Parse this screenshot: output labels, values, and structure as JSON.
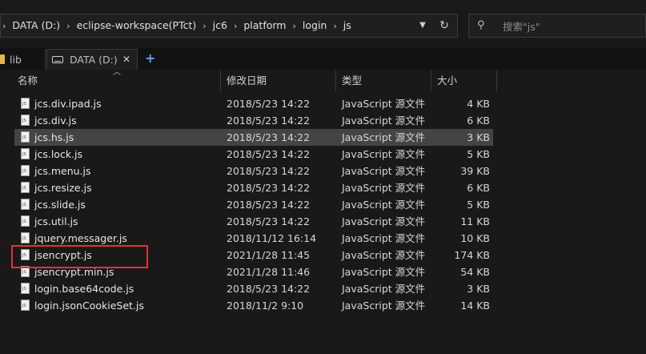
{
  "window": {
    "title_fragment": ""
  },
  "address": {
    "crumbs": [
      "DATA (D:)",
      "eclipse-workspace(PTct)",
      "jc6",
      "platform",
      "login",
      "js"
    ],
    "separator": "›"
  },
  "search": {
    "placeholder": "搜索\"js\""
  },
  "tabs": [
    {
      "label": "lib"
    },
    {
      "label": "DATA (D:)"
    }
  ],
  "columns": {
    "name": "名称",
    "date": "修改日期",
    "type": "类型",
    "size": "大小"
  },
  "files": [
    {
      "name": "jcs.div.ipad.js",
      "date": "2018/5/23 14:22",
      "type": "JavaScript 源文件",
      "size": "4 KB"
    },
    {
      "name": "jcs.div.js",
      "date": "2018/5/23 14:22",
      "type": "JavaScript 源文件",
      "size": "6 KB"
    },
    {
      "name": "jcs.hs.js",
      "date": "2018/5/23 14:22",
      "type": "JavaScript 源文件",
      "size": "3 KB",
      "selected": true
    },
    {
      "name": "jcs.lock.js",
      "date": "2018/5/23 14:22",
      "type": "JavaScript 源文件",
      "size": "5 KB"
    },
    {
      "name": "jcs.menu.js",
      "date": "2018/5/23 14:22",
      "type": "JavaScript 源文件",
      "size": "39 KB"
    },
    {
      "name": "jcs.resize.js",
      "date": "2018/5/23 14:22",
      "type": "JavaScript 源文件",
      "size": "6 KB"
    },
    {
      "name": "jcs.slide.js",
      "date": "2018/5/23 14:22",
      "type": "JavaScript 源文件",
      "size": "5 KB"
    },
    {
      "name": "jcs.util.js",
      "date": "2018/5/23 14:22",
      "type": "JavaScript 源文件",
      "size": "11 KB"
    },
    {
      "name": "jquery.messager.js",
      "date": "2018/11/12 16:14",
      "type": "JavaScript 源文件",
      "size": "10 KB"
    },
    {
      "name": "jsencrypt.js",
      "date": "2021/1/28 11:45",
      "type": "JavaScript 源文件",
      "size": "174 KB",
      "highlighted": true
    },
    {
      "name": "jsencrypt.min.js",
      "date": "2021/1/28 11:46",
      "type": "JavaScript 源文件",
      "size": "54 KB"
    },
    {
      "name": "login.base64code.js",
      "date": "2018/5/23 14:22",
      "type": "JavaScript 源文件",
      "size": "3 KB"
    },
    {
      "name": "login.jsonCookieSet.js",
      "date": "2018/11/2 9:10",
      "type": "JavaScript 源文件",
      "size": "14 KB"
    }
  ],
  "colors": {
    "background": "#191919",
    "selected_row": "#444444",
    "highlight_box": "#e33333",
    "folder": "#e2b64a",
    "accent": "#5aa0ff"
  }
}
